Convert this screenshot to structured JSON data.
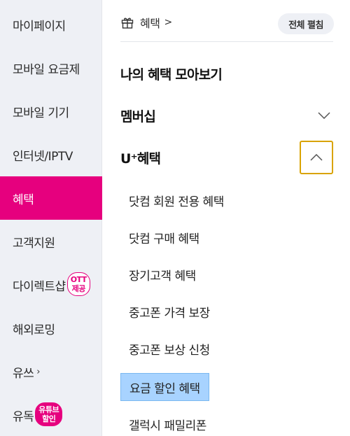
{
  "sidebar": {
    "items": [
      {
        "label": "마이페이지"
      },
      {
        "label": "모바일 요금제"
      },
      {
        "label": "모바일 기기"
      },
      {
        "label": "인터넷/IPTV"
      },
      {
        "label": "혜택",
        "active": true
      },
      {
        "label": "고객지원"
      },
      {
        "label": "다이렉트샵",
        "badge": [
          "OTT",
          "제공"
        ]
      },
      {
        "label": "해외로밍"
      },
      {
        "label": "유쓰",
        "chevron": "›"
      },
      {
        "label": "유독",
        "badge": [
          "유튜브",
          "할인"
        ]
      }
    ]
  },
  "header": {
    "breadcrumb": "혜택",
    "breadcrumb_arrow": ">",
    "expand_all": "전체 펼침",
    "icon": "gift-icon"
  },
  "sections": {
    "my_benefits": "나의 혜택 모아보기",
    "membership": "멤버십",
    "uplus_benefits": "U⁺혜택"
  },
  "uplus_items": [
    "닷컴 회원 전용 혜택",
    "닷컴 구매 혜택",
    "장기고객 혜택",
    "중고폰 가격 보장",
    "중고폰 보상 신청",
    "요금 할인 혜택",
    "갤럭시 패밀리폰"
  ],
  "colors": {
    "accent": "#e6007e",
    "sidebar_bg": "#eef0f5",
    "highlight": "#a8d3ff",
    "focus_ring": "#d9a300"
  }
}
